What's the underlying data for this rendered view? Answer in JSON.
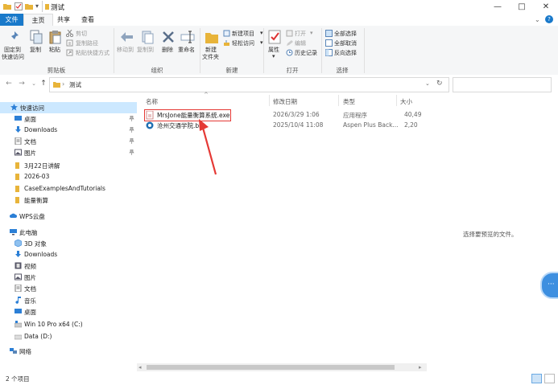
{
  "window": {
    "title": "测试",
    "controls": {
      "minimize": "—",
      "maximize": "□",
      "close": "✕"
    }
  },
  "ribbon_tabs": [
    {
      "label": "文件"
    },
    {
      "label": "主页"
    },
    {
      "label": "共享"
    },
    {
      "label": "查看"
    }
  ],
  "ribbon": {
    "clipboard": {
      "pin_label1": "固定到",
      "pin_label2": "快速访问",
      "copy": "复制",
      "paste": "粘贴",
      "cut": "剪切",
      "copy_path": "复制路径",
      "paste_shortcut": "粘贴快捷方式",
      "group": "剪贴板"
    },
    "organize": {
      "move_to": "移动到",
      "copy_to": "复制到",
      "delete": "删除",
      "rename": "重命名",
      "group": "组织"
    },
    "new": {
      "new_folder1": "新建",
      "new_folder2": "文件夹",
      "new_item": "新建项目",
      "easy_access": "轻松访问",
      "group": "新建"
    },
    "open": {
      "properties": "属性",
      "open": "打开",
      "edit": "编辑",
      "history": "历史记录",
      "group": "打开"
    },
    "select": {
      "select_all": "全部选择",
      "select_none": "全部取消",
      "invert": "反向选择",
      "group": "选择"
    }
  },
  "address": {
    "breadcrumb_sep": "›",
    "path": "测试",
    "search_placeholder": ""
  },
  "nav_pane": {
    "quick_access": "快速访问",
    "quick_items": [
      {
        "label": "桌面",
        "pinned": true
      },
      {
        "label": "Downloads",
        "pinned": true
      },
      {
        "label": "文档",
        "pinned": true
      },
      {
        "label": "图片",
        "pinned": true
      },
      {
        "label": "3月22日讲解",
        "pinned": false
      },
      {
        "label": "2026-03",
        "pinned": false
      },
      {
        "label": "CaseExamplesAndTutorials",
        "pinned": false
      },
      {
        "label": "能量衡算",
        "pinned": false
      }
    ],
    "wps": "WPS云盘",
    "this_pc": "此电脑",
    "pc_items": [
      {
        "label": "3D 对象"
      },
      {
        "label": "Downloads"
      },
      {
        "label": "视频"
      },
      {
        "label": "图片"
      },
      {
        "label": "文档"
      },
      {
        "label": "音乐"
      },
      {
        "label": "桌面"
      },
      {
        "label": "Win 10 Pro x64 (C:)"
      },
      {
        "label": "Data (D:)"
      }
    ],
    "network": "网络"
  },
  "columns": {
    "name": "名称",
    "date": "修改日期",
    "type": "类型",
    "size": "大小"
  },
  "files": [
    {
      "name": "MrsJone能量衡算系统.exe",
      "date": "2026/3/29 1:06",
      "type": "应用程序",
      "size": "40,49"
    },
    {
      "name": "沧州交通学院.bkp",
      "date": "2025/10/4 11:08",
      "type": "Aspen Plus Back...",
      "size": "2,20"
    }
  ],
  "preview": "选择要预览的文件。",
  "status": {
    "count": "2 个项目"
  },
  "colors": {
    "accent": "#1979ca",
    "highlight": "#e53935",
    "selected": "#cce8ff"
  }
}
